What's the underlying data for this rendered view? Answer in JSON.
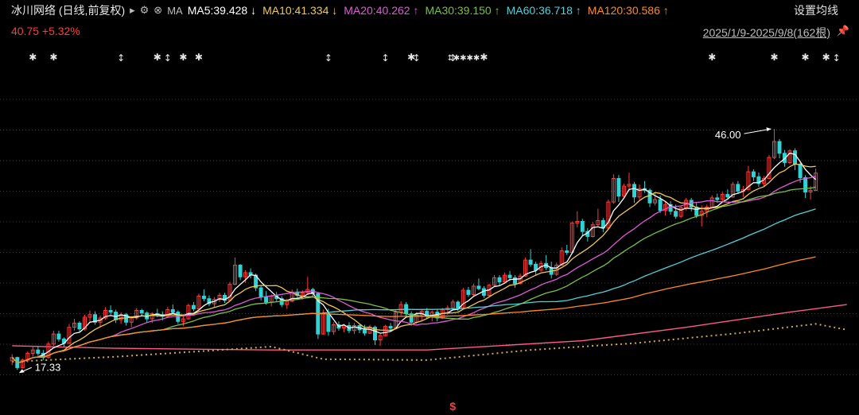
{
  "header": {
    "title": "冰川网络 (日线,前复权)",
    "title_arrow": "▸",
    "tools_label": "MA",
    "ma_readouts": [
      {
        "label": "MA5:39.428",
        "trend": "↓",
        "color": "#ffffff"
      },
      {
        "label": "MA10:41.334",
        "trend": "↓",
        "color": "#f2c94c"
      },
      {
        "label": "MA20:40.262",
        "trend": "↑",
        "color": "#e05ad8"
      },
      {
        "label": "MA30:39.150",
        "trend": "↑",
        "color": "#7cc040"
      },
      {
        "label": "MA60:36.718",
        "trend": "↑",
        "color": "#4fd1d9"
      },
      {
        "label": "MA120:30.586",
        "trend": "↑",
        "color": "#ff8c1a"
      }
    ],
    "settings_label": "设置均线",
    "price_label": "40.75 +5.32%",
    "date_range": "2025/1/9-2025/9/8(162根)"
  },
  "colors": {
    "up": "#ff3b3b",
    "down": "#2fd3d3",
    "grid": "#3a3a3a",
    "ma250": "#ff5a8a",
    "ma_gold": "#d4a940"
  },
  "chart_data": {
    "type": "candlestick",
    "x_count": 162,
    "x_start": "2025/1/9",
    "x_end": "2025/9/8",
    "ylim": [
      14.8,
      53.3
    ],
    "grid": true,
    "annotations": {
      "high": "46.00",
      "low": "17.33"
    },
    "candles": [
      [
        18.4,
        19.2,
        17.9,
        18.8
      ],
      [
        18.8,
        18.9,
        17.33,
        17.6
      ],
      [
        17.6,
        18.7,
        17.5,
        18.5
      ],
      [
        18.5,
        19.5,
        18.2,
        19.3
      ],
      [
        19.3,
        20.2,
        18.9,
        19.7
      ],
      [
        19.7,
        20.1,
        19.0,
        19.3
      ],
      [
        19.3,
        19.7,
        18.5,
        18.8
      ],
      [
        18.8,
        20.7,
        18.7,
        20.4
      ],
      [
        20.4,
        22.0,
        20.2,
        21.6
      ],
      [
        21.6,
        22.0,
        20.7,
        21.0
      ],
      [
        21.0,
        21.2,
        20.1,
        20.5
      ],
      [
        20.5,
        22.8,
        20.4,
        22.4
      ],
      [
        22.4,
        23.4,
        22.0,
        22.9
      ],
      [
        22.9,
        23.1,
        21.9,
        22.2
      ],
      [
        22.2,
        23.9,
        22.0,
        23.6
      ],
      [
        23.6,
        24.4,
        23.0,
        23.9
      ],
      [
        23.9,
        24.3,
        22.7,
        23.0
      ],
      [
        23.0,
        23.8,
        22.4,
        23.5
      ],
      [
        23.5,
        24.8,
        23.3,
        24.4
      ],
      [
        24.4,
        25.0,
        23.9,
        24.2
      ],
      [
        24.2,
        24.5,
        22.9,
        23.3
      ],
      [
        23.3,
        24.2,
        22.8,
        23.9
      ],
      [
        23.9,
        24.1,
        22.6,
        23.0
      ],
      [
        23.0,
        23.7,
        22.4,
        23.5
      ],
      [
        23.5,
        24.7,
        23.3,
        24.4
      ],
      [
        24.4,
        24.6,
        23.8,
        24.1
      ],
      [
        24.1,
        24.3,
        23.0,
        23.4
      ],
      [
        23.4,
        24.2,
        22.9,
        24.0
      ],
      [
        24.0,
        24.6,
        23.6,
        23.9
      ],
      [
        23.9,
        24.3,
        23.2,
        23.7
      ],
      [
        23.7,
        24.8,
        23.5,
        24.5
      ],
      [
        24.5,
        25.1,
        24.0,
        24.2
      ],
      [
        24.2,
        24.4,
        22.8,
        23.1
      ],
      [
        23.1,
        23.7,
        22.5,
        23.4
      ],
      [
        23.4,
        25.2,
        23.3,
        25.0
      ],
      [
        25.0,
        25.4,
        24.3,
        24.6
      ],
      [
        24.6,
        26.4,
        24.5,
        26.1
      ],
      [
        26.1,
        26.9,
        25.5,
        25.8
      ],
      [
        25.8,
        26.2,
        24.9,
        25.2
      ],
      [
        25.2,
        26.0,
        24.8,
        25.7
      ],
      [
        25.7,
        26.5,
        25.4,
        26.2
      ],
      [
        26.2,
        26.5,
        25.3,
        25.6
      ],
      [
        25.6,
        27.8,
        25.5,
        27.5
      ],
      [
        27.5,
        30.7,
        27.4,
        29.8
      ],
      [
        29.8,
        29.9,
        28.0,
        28.4
      ],
      [
        28.4,
        29.2,
        27.7,
        28.9
      ],
      [
        28.9,
        29.4,
        28.2,
        28.6
      ],
      [
        28.6,
        28.8,
        26.7,
        27.1
      ],
      [
        27.1,
        27.3,
        25.6,
        26.0
      ],
      [
        26.0,
        26.7,
        25.1,
        25.4
      ],
      [
        25.4,
        26.3,
        24.9,
        26.1
      ],
      [
        26.1,
        26.6,
        25.5,
        25.8
      ],
      [
        25.8,
        26.1,
        24.8,
        25.1
      ],
      [
        25.1,
        25.8,
        24.6,
        25.5
      ],
      [
        25.5,
        26.9,
        25.4,
        26.6
      ],
      [
        26.6,
        27.0,
        25.9,
        26.2
      ],
      [
        26.2,
        26.8,
        25.7,
        26.5
      ],
      [
        26.5,
        28.4,
        26.4,
        26.9
      ],
      [
        26.9,
        27.1,
        26.1,
        26.4
      ],
      [
        26.4,
        26.6,
        21.0,
        21.6
      ],
      [
        21.6,
        24.5,
        21.5,
        24.0
      ],
      [
        24.0,
        24.6,
        21.4,
        21.9
      ],
      [
        21.9,
        23.0,
        21.5,
        22.7
      ],
      [
        22.7,
        23.1,
        22.0,
        22.3
      ],
      [
        22.3,
        22.8,
        21.8,
        22.6
      ],
      [
        22.6,
        23.0,
        21.7,
        22.0
      ],
      [
        22.0,
        22.9,
        21.6,
        22.6
      ],
      [
        22.6,
        22.8,
        21.7,
        22.1
      ],
      [
        22.1,
        22.7,
        21.4,
        21.7
      ],
      [
        21.7,
        22.7,
        21.6,
        22.4
      ],
      [
        22.4,
        22.6,
        20.3,
        20.9
      ],
      [
        20.9,
        21.6,
        20.2,
        21.4
      ],
      [
        21.4,
        22.7,
        21.3,
        22.5
      ],
      [
        22.5,
        22.9,
        21.9,
        22.3
      ],
      [
        22.3,
        24.5,
        22.2,
        24.2
      ],
      [
        24.2,
        25.5,
        23.8,
        25.1
      ],
      [
        25.1,
        25.4,
        23.7,
        24.0
      ],
      [
        24.0,
        24.3,
        22.6,
        23.0
      ],
      [
        23.0,
        24.2,
        22.8,
        23.9
      ],
      [
        23.9,
        24.5,
        23.2,
        24.3
      ],
      [
        24.3,
        24.7,
        23.4,
        23.7
      ],
      [
        23.7,
        24.4,
        23.1,
        24.2
      ],
      [
        24.2,
        24.6,
        23.1,
        23.5
      ],
      [
        23.5,
        24.7,
        23.4,
        24.5
      ],
      [
        24.5,
        25.0,
        23.9,
        24.7
      ],
      [
        24.7,
        25.7,
        24.4,
        25.4
      ],
      [
        25.4,
        25.6,
        24.3,
        24.6
      ],
      [
        24.6,
        27.1,
        24.5,
        26.8
      ],
      [
        26.8,
        27.2,
        26.0,
        26.3
      ],
      [
        26.3,
        27.6,
        26.1,
        27.3
      ],
      [
        27.3,
        28.2,
        26.8,
        27.0
      ],
      [
        27.0,
        27.3,
        25.9,
        26.2
      ],
      [
        26.2,
        27.6,
        26.0,
        27.4
      ],
      [
        27.4,
        28.6,
        27.2,
        28.3
      ],
      [
        28.3,
        28.6,
        27.4,
        27.8
      ],
      [
        27.8,
        28.9,
        27.6,
        28.6
      ],
      [
        28.6,
        29.1,
        27.9,
        28.3
      ],
      [
        28.3,
        28.6,
        27.1,
        27.6
      ],
      [
        27.6,
        28.8,
        27.5,
        28.5
      ],
      [
        28.5,
        30.7,
        28.4,
        30.4
      ],
      [
        30.4,
        31.7,
        29.6,
        29.9
      ],
      [
        29.9,
        30.2,
        28.6,
        29.2
      ],
      [
        29.2,
        30.3,
        29.0,
        30.0
      ],
      [
        30.0,
        31.0,
        29.2,
        29.5
      ],
      [
        29.5,
        30.2,
        28.2,
        28.7
      ],
      [
        28.7,
        30.1,
        28.5,
        29.8
      ],
      [
        29.8,
        31.9,
        29.7,
        31.5
      ],
      [
        31.5,
        32.2,
        31.0,
        31.3
      ],
      [
        31.3,
        35.0,
        31.2,
        34.8
      ],
      [
        34.8,
        36.2,
        34.3,
        35.0
      ],
      [
        35.0,
        35.3,
        33.3,
        33.8
      ],
      [
        33.8,
        34.2,
        32.6,
        33.2
      ],
      [
        33.2,
        34.9,
        33.1,
        34.6
      ],
      [
        34.6,
        36.5,
        34.3,
        35.1
      ],
      [
        35.1,
        35.4,
        33.7,
        34.2
      ],
      [
        34.2,
        37.6,
        34.1,
        37.3
      ],
      [
        37.3,
        40.6,
        37.1,
        40.1
      ],
      [
        40.1,
        40.5,
        37.3,
        38.0
      ],
      [
        38.0,
        39.5,
        37.7,
        39.2
      ],
      [
        39.2,
        40.8,
        38.6,
        39.4
      ],
      [
        39.4,
        39.7,
        37.2,
        37.9
      ],
      [
        37.9,
        39.4,
        37.6,
        38.9
      ],
      [
        38.9,
        39.8,
        38.4,
        38.7
      ],
      [
        38.7,
        38.9,
        36.7,
        37.2
      ],
      [
        37.2,
        38.4,
        36.9,
        37.6
      ],
      [
        37.6,
        38.1,
        36.0,
        36.3
      ],
      [
        36.3,
        37.3,
        35.7,
        37.0
      ],
      [
        37.0,
        37.4,
        35.8,
        36.2
      ],
      [
        36.2,
        37.0,
        35.3,
        35.6
      ],
      [
        35.6,
        36.9,
        35.4,
        36.6
      ],
      [
        36.6,
        37.8,
        36.3,
        37.5
      ],
      [
        37.5,
        37.8,
        36.2,
        36.7
      ],
      [
        36.7,
        37.2,
        35.4,
        35.7
      ],
      [
        35.7,
        36.9,
        34.4,
        36.2
      ],
      [
        36.2,
        37.0,
        35.5,
        36.7
      ],
      [
        36.7,
        38.1,
        36.6,
        37.8
      ],
      [
        37.8,
        38.3,
        37.2,
        37.6
      ],
      [
        37.6,
        38.5,
        37.3,
        38.2
      ],
      [
        38.2,
        38.8,
        37.6,
        37.9
      ],
      [
        37.9,
        39.7,
        37.8,
        39.4
      ],
      [
        39.4,
        39.8,
        38.3,
        38.6
      ],
      [
        38.6,
        39.2,
        37.9,
        38.8
      ],
      [
        38.8,
        41.6,
        38.7,
        40.9
      ],
      [
        40.9,
        41.2,
        39.8,
        40.3
      ],
      [
        40.3,
        40.8,
        39.1,
        39.5
      ],
      [
        39.5,
        40.4,
        39.1,
        40.1
      ],
      [
        40.1,
        42.9,
        40.0,
        42.6
      ],
      [
        42.6,
        46.0,
        42.4,
        44.5
      ],
      [
        44.5,
        44.8,
        42.5,
        43.1
      ],
      [
        43.1,
        43.5,
        41.5,
        42.0
      ],
      [
        42.0,
        43.6,
        41.8,
        43.4
      ],
      [
        43.4,
        43.7,
        41.1,
        41.8
      ],
      [
        41.8,
        42.0,
        39.6,
        40.2
      ],
      [
        40.2,
        40.5,
        37.8,
        38.5
      ],
      [
        38.5,
        39.2,
        37.6,
        38.69
      ],
      [
        38.69,
        41.3,
        38.6,
        40.75
      ]
    ],
    "moving_averages": [
      {
        "name": "MA5",
        "period": 5,
        "color": "#ffffff"
      },
      {
        "name": "MA10",
        "period": 10,
        "color": "#f2c94c"
      },
      {
        "name": "MA20",
        "period": 20,
        "color": "#e05ad8"
      },
      {
        "name": "MA30",
        "period": 30,
        "color": "#7cc040"
      },
      {
        "name": "MA60",
        "period": 60,
        "color": "#4fd1d9"
      },
      {
        "name": "MA120",
        "period": 120,
        "color": "#ff8c1a"
      }
    ],
    "ma250_line": {
      "color": "#ff5a8a",
      "points": [
        [
          0,
          20.2
        ],
        [
          20,
          19.9
        ],
        [
          50,
          19.7
        ],
        [
          80,
          19.7
        ],
        [
          110,
          20.8
        ],
        [
          130,
          22.4
        ],
        [
          150,
          24.2
        ],
        [
          161,
          25.1
        ]
      ]
    },
    "ma_gold_line": {
      "color": "#d4a940",
      "points": [
        [
          0,
          18.3
        ],
        [
          20,
          18.9
        ],
        [
          50,
          20.1
        ],
        [
          60,
          18.6
        ],
        [
          80,
          18.5
        ],
        [
          100,
          19.7
        ],
        [
          120,
          20.5
        ],
        [
          140,
          21.7
        ],
        [
          155,
          22.8
        ],
        [
          161,
          22.1
        ]
      ]
    },
    "event_markers": {
      "star_indices": [
        4,
        8,
        28,
        33,
        36,
        77,
        91,
        135,
        147,
        153,
        157
      ],
      "arrow_indices": [
        21,
        30,
        61,
        72,
        78,
        85,
        159
      ],
      "dense_index": 87
    },
    "bottom_marker_index": 85
  }
}
